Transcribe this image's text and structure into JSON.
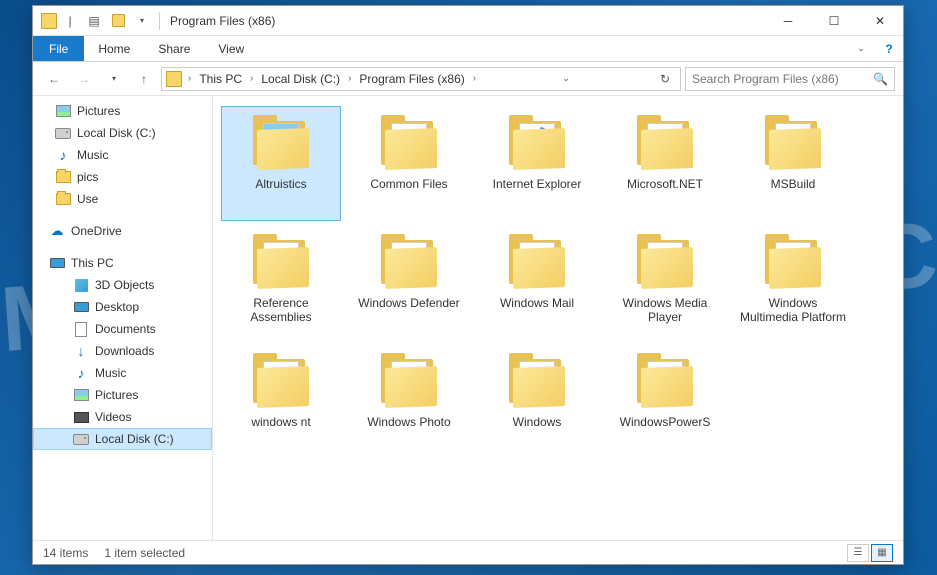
{
  "watermark": "MYANTISPYWARE.COM",
  "title": "Program Files (x86)",
  "ribbon": {
    "file": "File",
    "home": "Home",
    "share": "Share",
    "view": "View"
  },
  "breadcrumb": [
    "This PC",
    "Local Disk (C:)",
    "Program Files (x86)"
  ],
  "search": {
    "placeholder": "Search Program Files (x86)"
  },
  "nav": {
    "pictures": "Pictures",
    "localdisk": "Local Disk (C:)",
    "music": "Music",
    "pics": "pics",
    "use": "Use",
    "onedrive": "OneDrive",
    "thispc": "This PC",
    "objects3d": "3D Objects",
    "desktop": "Desktop",
    "documents": "Documents",
    "downloads": "Downloads",
    "music2": "Music",
    "pictures2": "Pictures",
    "videos": "Videos",
    "localdisk2": "Local Disk (C:)"
  },
  "files": [
    {
      "name": "Altruistics",
      "type": "thumb",
      "selected": true
    },
    {
      "name": "Common Files",
      "type": "lines"
    },
    {
      "name": "Internet Explorer",
      "type": "ie"
    },
    {
      "name": "Microsoft.NET",
      "type": "lines"
    },
    {
      "name": "MSBuild",
      "type": "plain"
    },
    {
      "name": "Reference Assemblies",
      "type": "plain"
    },
    {
      "name": "Windows Defender",
      "type": "lines"
    },
    {
      "name": "Windows Mail",
      "type": "plain"
    },
    {
      "name": "Windows Media Player",
      "type": "gear"
    },
    {
      "name": "Windows Multimedia Platform",
      "type": "gear"
    },
    {
      "name": "windows nt",
      "type": "plain"
    },
    {
      "name": "Windows Photo",
      "type": "gear"
    },
    {
      "name": "Windows",
      "type": "gear"
    },
    {
      "name": "WindowsPowerS",
      "type": "plain"
    }
  ],
  "status": {
    "count": "14 items",
    "selected": "1 item selected"
  }
}
